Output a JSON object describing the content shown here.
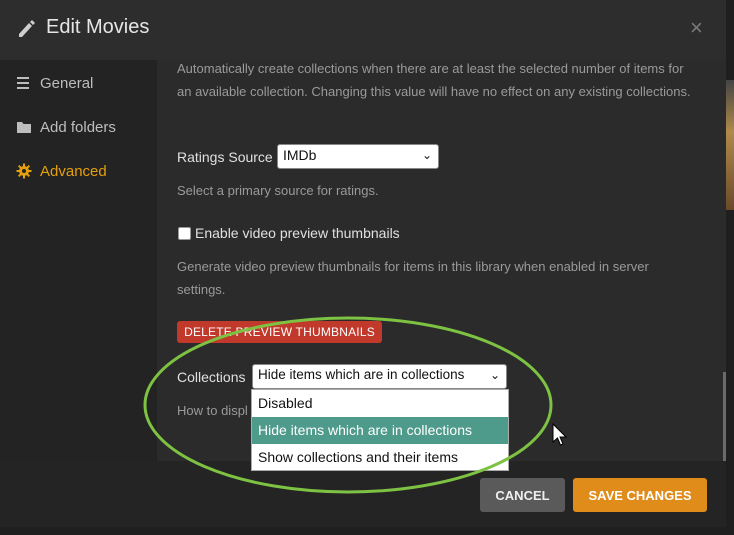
{
  "dialog": {
    "title": "Edit Movies",
    "close_glyph": "×"
  },
  "sidebar": {
    "items": [
      {
        "label": "General",
        "icon": "list-icon"
      },
      {
        "label": "Add folders",
        "icon": "folder-icon"
      },
      {
        "label": "Advanced",
        "icon": "gear-icon",
        "active": true
      }
    ]
  },
  "content": {
    "auto_collections_help": "Automatically create collections when there are at least the selected number of items for an available collection. Changing this value will have no effect on any existing collections.",
    "ratings_source": {
      "label": "Ratings Source",
      "value": "IMDb",
      "help": "Select a primary source for ratings."
    },
    "video_preview": {
      "label": "Enable video preview thumbnails",
      "checked": false,
      "help": "Generate video preview thumbnails for items in this library when enabled in server settings."
    },
    "delete_button": "DELETE PREVIEW THUMBNAILS",
    "collections": {
      "label": "Collections",
      "value": "Hide items which are in collections",
      "help_visible": "How to displ",
      "options": [
        "Disabled",
        "Hide items which are in collections",
        "Show collections and their items"
      ]
    }
  },
  "footer": {
    "cancel": "CANCEL",
    "save": "SAVE CHANGES"
  },
  "colors": {
    "accent": "#e5a00d",
    "save": "#e08c1a",
    "danger": "#c0392b",
    "selected_option": "#4e9a8b",
    "annotation": "#7dc242"
  }
}
